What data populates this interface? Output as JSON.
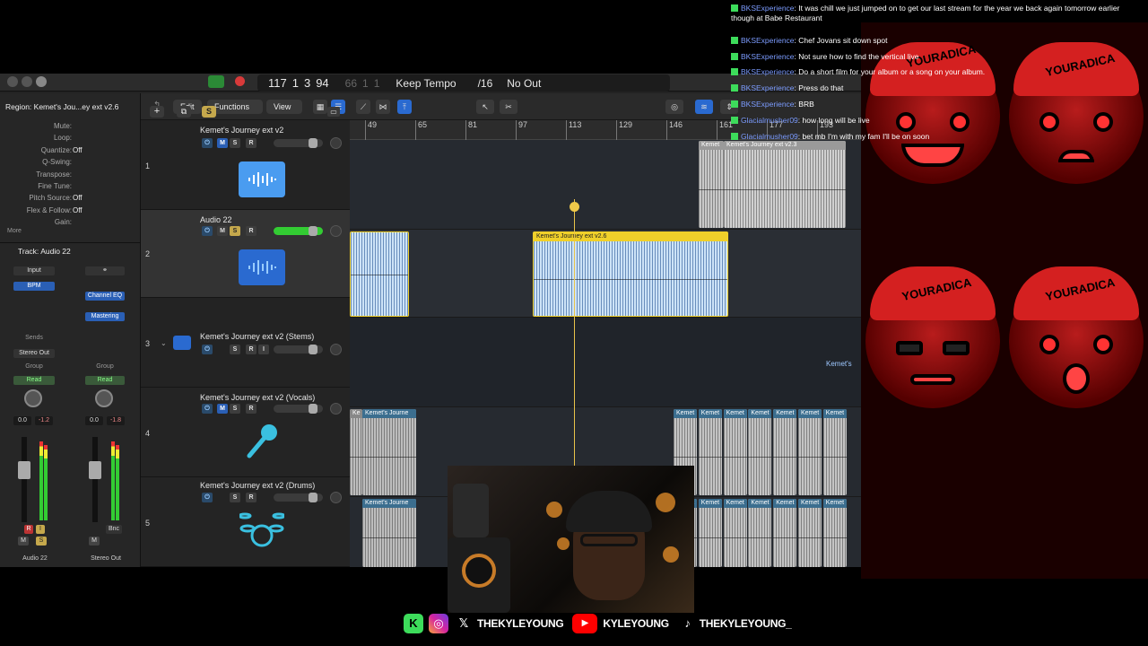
{
  "transport": {
    "bar": "117",
    "beat": "1",
    "div": "3",
    "tick": "94",
    "end_bar": "66",
    "end_beat": "1",
    "end_div": "1",
    "tempo_mode": "Keep Tempo",
    "division": "/16",
    "midi_out": "No Out"
  },
  "inspector": {
    "region_title": "Region: Kemet's Jou...ey ext v2.6",
    "rows": [
      {
        "label": "Mute:",
        "value": ""
      },
      {
        "label": "Loop:",
        "value": ""
      },
      {
        "label": "Quantize:",
        "value": "Off"
      },
      {
        "label": "Q-Swing:",
        "value": ""
      },
      {
        "label": "Transpose:",
        "value": ""
      },
      {
        "label": "Fine Tune:",
        "value": ""
      },
      {
        "label": "Pitch Source:",
        "value": "Off"
      },
      {
        "label": "Flex & Follow:",
        "value": "Off"
      },
      {
        "label": "Gain:",
        "value": ""
      }
    ],
    "more": "More",
    "track_title": "Track: Audio 22"
  },
  "mixer": {
    "left": {
      "input": "Input",
      "bpm": "BPM",
      "sends": "Sends",
      "output": "Stereo Out",
      "group": "Group",
      "automation": "Read",
      "vol": "0.0",
      "peak": "-1.2",
      "m": "M",
      "s": "S",
      "r": "R",
      "i": "I",
      "name": "Audio 22"
    },
    "right": {
      "plugin1": "Channel EQ",
      "plugin2": "Mastering",
      "group": "Group",
      "automation": "Read",
      "vol": "0.0",
      "peak": "-1.8",
      "bnc": "Bnc",
      "m": "M",
      "name": "Stereo Out"
    }
  },
  "toolbar": {
    "edit": "Edit",
    "functions": "Functions",
    "view": "View",
    "add": "+",
    "solo": "S"
  },
  "ruler": [
    "49",
    "65",
    "81",
    "97",
    "113",
    "129",
    "146",
    "161",
    "177",
    "193"
  ],
  "tracks": [
    {
      "num": "1",
      "name": "Kemet's Journey ext v2",
      "m": "M",
      "s": "S",
      "r": "R"
    },
    {
      "num": "2",
      "name": "Audio 22",
      "m": "M",
      "s": "S",
      "r": "R"
    },
    {
      "num": "3",
      "name": "Kemet's Journey ext v2 (Stems)",
      "s": "S",
      "r": "R",
      "i": "I"
    },
    {
      "num": "4",
      "name": "Kemet's Journey ext v2 (Vocals)",
      "m": "M",
      "s": "S",
      "r": "R"
    },
    {
      "num": "5",
      "name": "Kemet's Journey ext v2 (Drums)",
      "s": "S",
      "r": "R"
    }
  ],
  "regions": {
    "t1_a": "Kemet",
    "t1_b": "Kemet's Journey ext v2.3",
    "t2_sel": "Kemet's Journey ext v2.6",
    "t3_tail": "Kemet's",
    "t4_a": "Ke",
    "t4_b": "Kemet's Journe",
    "t4_rep": [
      "Kemet",
      "Kemet",
      "Kemet",
      "Kemet",
      "Kemet",
      "Kemet",
      "Kemet"
    ],
    "t5_b": "Kemet's Journe",
    "t5_rep": [
      "Kemet",
      "Kemet",
      "Kemet",
      "Kemet",
      "Kemet",
      "Kemet",
      "Kemet"
    ]
  },
  "chat": [
    {
      "user": "BKSExperience",
      "text": "It was chill we just jumped on to get our last stream for the year we back again tomorrow earlier though at Babe Restaurant"
    },
    {
      "user": "BKSExperience",
      "text": "Chef Jovans sit down spot"
    },
    {
      "user": "BKSExperience",
      "text": "Not sure how to find the vertical live"
    },
    {
      "user": "BKSExperience",
      "text": "Do a short film for your album or a song on your album."
    },
    {
      "user": "BKSExperience",
      "text": "Press do that"
    },
    {
      "user": "BKSExperience",
      "text": "BRB"
    },
    {
      "user": "Glacialmusher09",
      "text": "how long will be live"
    },
    {
      "user": "Glacialmusher09",
      "text": "bet mb I'm with my fam I'll be on soon"
    }
  ],
  "overlay": {
    "brand": "YOURADICA"
  },
  "socials": {
    "x": "THEKYLEYOUNG",
    "youtube": "KYLEYOUNG",
    "tiktok": "THEKYLEYOUNG_"
  },
  "colors": {
    "accent_yellow": "#f0d02a",
    "region_blue": "#cde3f7",
    "kick_green": "#3ddc5b",
    "chat_user": "#7c9cff",
    "overlay_red": "#d42020"
  }
}
